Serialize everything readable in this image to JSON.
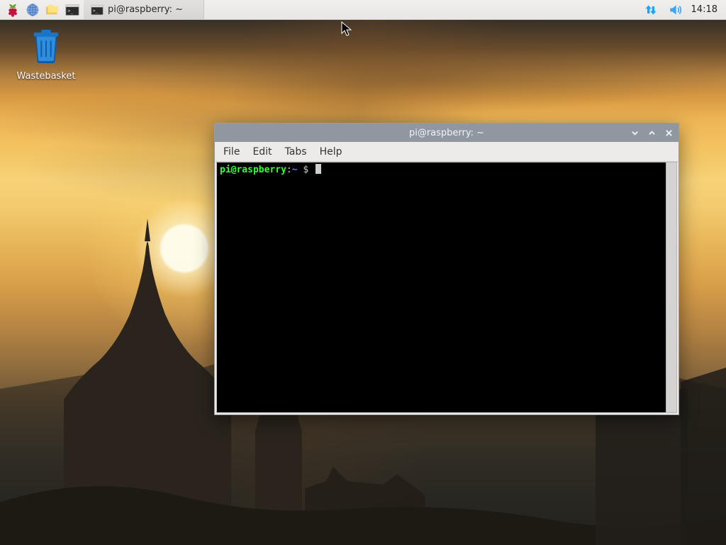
{
  "taskbar": {
    "task_items": [
      {
        "label": "pi@raspberry: ~"
      }
    ],
    "clock": "14:18"
  },
  "desktop": {
    "wastebasket_label": "Wastebasket"
  },
  "window": {
    "title": "pi@raspberry: ~",
    "menubar": {
      "file": "File",
      "edit": "Edit",
      "tabs": "Tabs",
      "help": "Help"
    },
    "prompt": {
      "user_host": "pi@raspberry",
      "colon": ":",
      "path": "~",
      "dollar": " $ "
    }
  },
  "colors": {
    "titlebar_bg": "#8f97a1",
    "window_bg": "#ecebe9",
    "tray_net": "#1fa2ff",
    "tray_vol": "#34a6ff",
    "term_user": "#33ff33",
    "term_path": "#5a7dff"
  }
}
